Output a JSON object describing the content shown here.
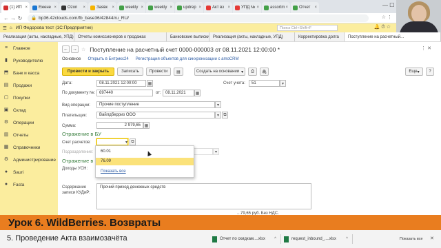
{
  "browser": {
    "tabs": [
      {
        "label": "(1) ИП",
        "color": "#d32f2f"
      },
      {
        "label": "Ежене",
        "color": "#1976d2"
      },
      {
        "label": "Ozon",
        "color": "#333333"
      },
      {
        "label": "Заявк",
        "color": "#f6b400"
      },
      {
        "label": "weekly",
        "color": "#43a047"
      },
      {
        "label": "weekly",
        "color": "#43a047"
      },
      {
        "label": "updrep",
        "color": "#43a047"
      },
      {
        "label": "Акт вз",
        "color": "#e53935"
      },
      {
        "label": "УПД №",
        "color": "#e53935"
      },
      {
        "label": "assortm",
        "color": "#43a047"
      },
      {
        "label": "Отчет",
        "color": "#43a047"
      }
    ],
    "url": "bp36.42clouds.com/fb_base36/42844/ru_RU/",
    "controls": "— ☐ ✕"
  },
  "onec": {
    "app_title": "ИП Федорова тест (1С:Предприятие)",
    "search_placeholder": "Поиск Ctrl+Shift+F",
    "window_tabs": [
      "Реализация (акты, накладные, УПД)",
      "Отчеты комиссионеров о продажах",
      "Банковские выписки",
      "Реализация (акты, накладные, УПД)",
      "Корректировка долга",
      "Поступление на расчетный..."
    ],
    "sidebar": [
      {
        "label": "Главное",
        "icon": "≡"
      },
      {
        "label": "Руководителю",
        "icon": "▮"
      },
      {
        "label": "Банк и касса",
        "icon": "⬒"
      },
      {
        "label": "Продажи",
        "icon": "▤"
      },
      {
        "label": "Покупки",
        "icon": "▢"
      },
      {
        "label": "Склад",
        "icon": "▣"
      },
      {
        "label": "Операции",
        "icon": "⚙"
      },
      {
        "label": "Отчеты",
        "icon": "▥"
      },
      {
        "label": "Справочники",
        "icon": "▦"
      },
      {
        "label": "Администрирование",
        "icon": "⚙"
      },
      {
        "label": "Sauri",
        "icon": "●"
      },
      {
        "label": "Fasta",
        "icon": "●"
      }
    ]
  },
  "document": {
    "title": "Поступление на расчетный счет 0000-000003 от 08.11.2021 12:00:00 *",
    "links": [
      "Основное",
      "Открыть в Битрикс24",
      "Регистрация объектов для синхронизации с amoCRM"
    ],
    "toolbar": {
      "post_close": "Провести и закрыть",
      "save": "Записать",
      "post": "Провести",
      "create_based": "Создать на основании",
      "more": "Еще",
      "help": "?"
    },
    "fields": {
      "date_label": "Дата:",
      "date_value": "08.11.2021 12:00:00",
      "account_label": "Счет учета:",
      "account_value": "51",
      "doc_no_label": "По документу №:",
      "doc_no_value": "697440",
      "from_label": "от:",
      "from_value": "08.11.2021",
      "op_label": "Вид операции:",
      "op_value": "Прочие поступление",
      "payer_label": "Плательщик:",
      "payer_value": "Вайлдберриз ООО",
      "sum_label": "Сумма:",
      "sum_value": "2 979,65"
    },
    "section_bu": "Отражение в БУ",
    "account_calc_label": "Счет расчетов:",
    "subdivision_label": "Подразделение:",
    "section_second": "Отражение в",
    "income_usn_label": "Доходы УСН:",
    "kudir_label": "Содержание записи КУДиР:",
    "kudir_value": "Прочий приход денежных средств",
    "payment_purpose": "...79,65 руб. Без НДС.",
    "dropdown": {
      "options": [
        "60.01",
        "76.09"
      ],
      "selected": "76.09",
      "show_all": "Показать все"
    }
  },
  "overlay": {
    "banner": "Урок 6. WildBerries. Возвраты",
    "lesson": "5. Проведение Акта взаимозачёта",
    "downloads": [
      "Отчет по скидкам....xlsx",
      "request_inbound_....xlsx"
    ],
    "show_all": "Показать все"
  },
  "colors": {
    "header_yellow": "#fbed9e",
    "primary_button": "#fbd93f",
    "section_green": "#3a7f3f",
    "banner_orange": "#e97d1f"
  }
}
